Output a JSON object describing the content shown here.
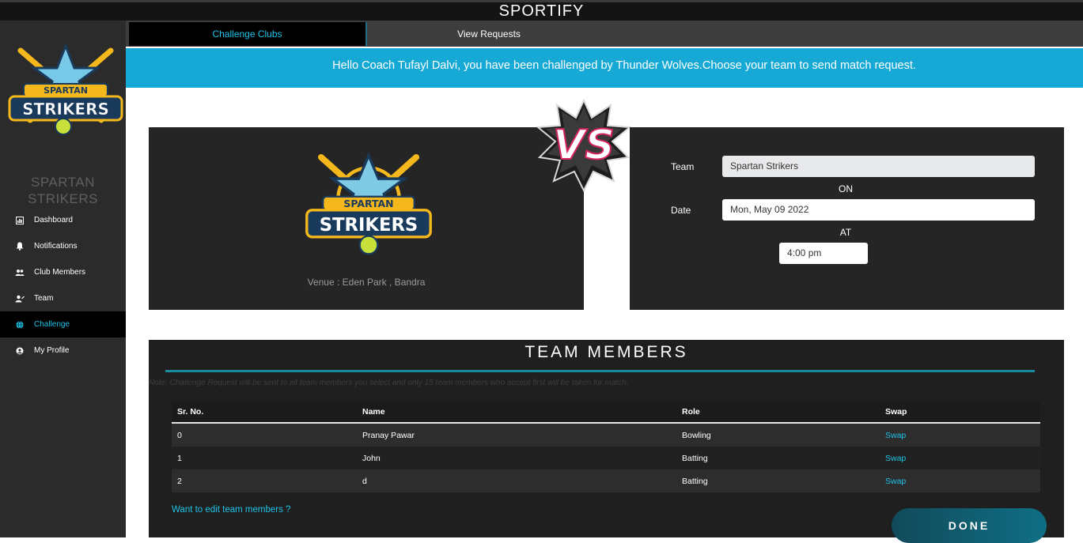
{
  "app": {
    "title": "SPORTIFY"
  },
  "tabs": [
    {
      "label": "Challenge Clubs",
      "active": true
    },
    {
      "label": "View Requests",
      "active": false
    }
  ],
  "sidebar": {
    "logo_text_top": "SPARTAN",
    "logo_text_bottom": "STRIKERS",
    "club_name_line1": "SPARTAN",
    "club_name_line2": "STRIKERS",
    "items": [
      {
        "label": "Dashboard",
        "icon": "dashboard-icon",
        "active": false
      },
      {
        "label": "Notifications",
        "icon": "bell-icon",
        "active": false
      },
      {
        "label": "Club Members",
        "icon": "group-icon",
        "active": false
      },
      {
        "label": "Team",
        "icon": "team-icon",
        "active": false
      },
      {
        "label": "Challenge",
        "icon": "globe-icon",
        "active": true
      },
      {
        "label": "My Profile",
        "icon": "profile-icon",
        "active": false
      }
    ]
  },
  "banner": {
    "message": "Hello Coach Tufayl Dalvi, you have been challenged by Thunder Wolves.Choose your team to send match request."
  },
  "club_card": {
    "venue": "Venue : Eden Park , Bandra"
  },
  "vs_badge": {
    "text": "VS"
  },
  "match_form": {
    "team_label": "Team",
    "team_value": "Spartan Strikers",
    "on_label": "ON",
    "date_label": "Date",
    "date_value": "Mon, May 09 2022",
    "at_label": "AT",
    "time_value": "4:00 pm"
  },
  "team_members": {
    "title": "TEAM MEMBERS",
    "note": "Note: Challenge Request will be sent to all team members you select and only 15 team members who accept first will be taken for match.",
    "columns": [
      "Sr. No.",
      "Name",
      "Role",
      "Swap"
    ],
    "rows": [
      {
        "sr": "0",
        "name": "Pranay Pawar",
        "role": "Bowling",
        "swap": "Swap"
      },
      {
        "sr": "1",
        "name": "John",
        "role": "Batting",
        "swap": "Swap"
      },
      {
        "sr": "2",
        "name": "d",
        "role": "Batting",
        "swap": "Swap"
      }
    ],
    "edit_link": "Want to edit team members ?",
    "done_label": "DONE"
  },
  "colors": {
    "accent": "#1ec3e8",
    "banner": "#17a9d6",
    "sidebar": "#2b2b2b",
    "panel": "#252525"
  }
}
